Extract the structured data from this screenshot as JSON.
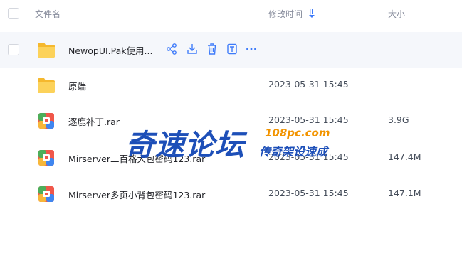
{
  "header": {
    "name_label": "文件名",
    "time_label": "修改时间",
    "size_label": "大小"
  },
  "files": [
    {
      "name": "NewopUI.Pak使用...",
      "time": "",
      "size": "",
      "type": "folder",
      "hovered": true
    },
    {
      "name": "原端",
      "time": "2023-05-31 15:45",
      "size": "-",
      "type": "folder"
    },
    {
      "name": "逐鹿补丁.rar",
      "time": "2023-05-31 15:45",
      "size": "3.9G",
      "type": "archive"
    },
    {
      "name": "Mirserver二百格大包密码123.rar",
      "time": "2023-05-31 15:45",
      "size": "147.4M",
      "type": "archive"
    },
    {
      "name": "Mirserver多页小背包密码123.rar",
      "time": "2023-05-31 15:45",
      "size": "147.1M",
      "type": "archive"
    }
  ],
  "row_actions": [
    "share-icon",
    "download-icon",
    "delete-icon",
    "rename-icon",
    "more-icon"
  ],
  "watermark": {
    "main": "奇速论坛",
    "site": "108pc.com",
    "slogan": "传奇架设速成"
  },
  "colors": {
    "accent": "#3e7bfa",
    "folder": "#f7c444",
    "watermark_blue": "#1d4fb8",
    "watermark_orange": "#f29400"
  }
}
